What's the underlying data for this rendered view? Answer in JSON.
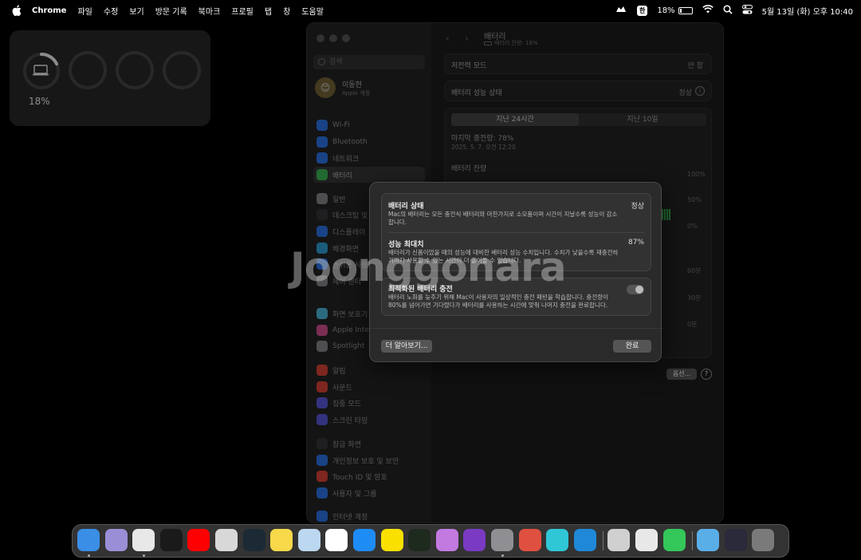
{
  "menubar": {
    "app_name": "Chrome",
    "menus": [
      "파일",
      "수정",
      "보기",
      "방문 기록",
      "북마크",
      "프로필",
      "탭",
      "창",
      "도움말"
    ],
    "input_badge": "한",
    "battery_pct": "18%",
    "battery_level": 0.18,
    "datetime": "5월 13일 (화) 오후 10:40"
  },
  "widget": {
    "battery_pct": "18%",
    "battery_level": 0.18
  },
  "window": {
    "search_placeholder": "검색",
    "profile_name": "이동현",
    "profile_sub": "Apple 계정",
    "sidebar_items": [
      {
        "label": "Wi-Fi",
        "color": "#2f7bf5"
      },
      {
        "label": "Bluetooth",
        "color": "#2f7bf5"
      },
      {
        "label": "네트워크",
        "color": "#2f7bf5"
      },
      {
        "label": "배터리",
        "color": "#3ec25a"
      },
      {
        "label": "일반",
        "color": "#8e8e93"
      },
      {
        "label": "데스크탑 및 Dock",
        "color": "#3a3a3c"
      },
      {
        "label": "디스플레이",
        "color": "#2f7bf5"
      },
      {
        "label": "배경화면",
        "color": "#32a8e0"
      },
      {
        "label": "손쉬운 사용",
        "color": "#2f7bf5"
      },
      {
        "label": "제어 센터",
        "color": "#8e8e93"
      },
      {
        "label": "화면 보호기",
        "color": "#4fc3e8"
      },
      {
        "label": "Apple Intelligence",
        "color": "#e0559a"
      },
      {
        "label": "Spotlight",
        "color": "#8e8e93"
      },
      {
        "label": "알림",
        "color": "#e5453a"
      },
      {
        "label": "사운드",
        "color": "#e5453a"
      },
      {
        "label": "집중 모드",
        "color": "#5e5ce6"
      },
      {
        "label": "스크린 타임",
        "color": "#5e5ce6"
      },
      {
        "label": "잠금 화면",
        "color": "#3a3a3c"
      },
      {
        "label": "개인정보 보호 및 보안",
        "color": "#2f7bf5"
      },
      {
        "label": "Touch ID 및 암호",
        "color": "#e5453a"
      },
      {
        "label": "사용자 및 그룹",
        "color": "#2f7bf5"
      },
      {
        "label": "인터넷 계정",
        "color": "#2f7bf5"
      }
    ],
    "title": "배터리",
    "subtitle": "배터리 잔량: 18%",
    "low_power_label": "저전력 모드",
    "low_power_value": "안 함",
    "health_label": "배터리 성능 상태",
    "health_value": "정상",
    "tab_24h": "지난 24시간",
    "tab_10d": "지난 10일",
    "last_charge": "마지막 충전량: 78%",
    "last_charge_date": "2025. 5. 7. 오전 12:20",
    "level_label": "배터리 잔량",
    "axis_pct": [
      "100%",
      "50%",
      "0%"
    ],
    "axis_min": [
      "60분",
      "30분",
      "0분"
    ],
    "options_button": "옵션...",
    "help_button": "?"
  },
  "dialog": {
    "health_title": "배터리 상태",
    "health_value": "정상",
    "health_desc": "Mac의 배터리는 모든 충전식 배터리와 마찬가지로 소모품이며 시간이 지날수록 성능이 감소합니다.",
    "capacity_title": "성능 최대치",
    "capacity_value": "87%",
    "capacity_desc": "배터리가 신품이었을 때의 성능에 대비한 배터리 성능 수치입니다. 수치가 낮을수록 재충전하기까지 사용할 수 있는 시간이 더 줄어들 수 있습니다.",
    "optimized_title": "최적화된 배터리 충전",
    "optimized_desc": "배터리 노화를 늦추기 위해 Mac이 사용자의 일상적인 충전 패턴을 학습합니다. 충전량이 80%를 넘어가면 기다렸다가 배터리를 사용하는 시간에 맞춰 나머지 충전을 완료합니다.",
    "optimized_on": true,
    "learn_more": "더 알아보기...",
    "done": "완료"
  },
  "watermark": "Joonggonara",
  "dock": [
    {
      "name": "finder-icon",
      "color": "#3a8ee6"
    },
    {
      "name": "launchpad-icon",
      "color": "#9a8fd6"
    },
    {
      "name": "chrome-icon",
      "color": "#e8e8e8"
    },
    {
      "name": "netflix-icon",
      "color": "#1a1a1a"
    },
    {
      "name": "youtube-icon",
      "color": "#ff0000"
    },
    {
      "name": "app-icon",
      "color": "#d8d8d8"
    },
    {
      "name": "league-icon",
      "color": "#1b2a35"
    },
    {
      "name": "notes-icon",
      "color": "#f7d94a"
    },
    {
      "name": "mouse-icon",
      "color": "#bcd7f0"
    },
    {
      "name": "chatgpt-icon",
      "color": "#ffffff"
    },
    {
      "name": "app-store-icon",
      "color": "#1e8cf5"
    },
    {
      "name": "kakaotalk-icon",
      "color": "#f9e000"
    },
    {
      "name": "activity-monitor-icon",
      "color": "#1e2a1e"
    },
    {
      "name": "audio-icon",
      "color": "#c27ae0"
    },
    {
      "name": "app2-icon",
      "color": "#7a3ac2"
    },
    {
      "name": "system-settings-icon",
      "color": "#8e8e93"
    },
    {
      "name": "iphone-mirroring-icon",
      "color": "#e05040"
    },
    {
      "name": "worlds-icon",
      "color": "#2fc6d6"
    },
    {
      "name": "vscode-icon",
      "color": "#1f88d8"
    },
    {
      "name": "calculator-icon",
      "color": "#d0d0d0"
    },
    {
      "name": "network-icon",
      "color": "#e8e8e8"
    },
    {
      "name": "facetime-icon",
      "color": "#34c759"
    },
    {
      "name": "downloads-folder-icon",
      "color": "#5aaee8"
    },
    {
      "name": "window-icon",
      "color": "#2a2a3a"
    },
    {
      "name": "trash-icon",
      "color": "#7a7a7a"
    }
  ]
}
